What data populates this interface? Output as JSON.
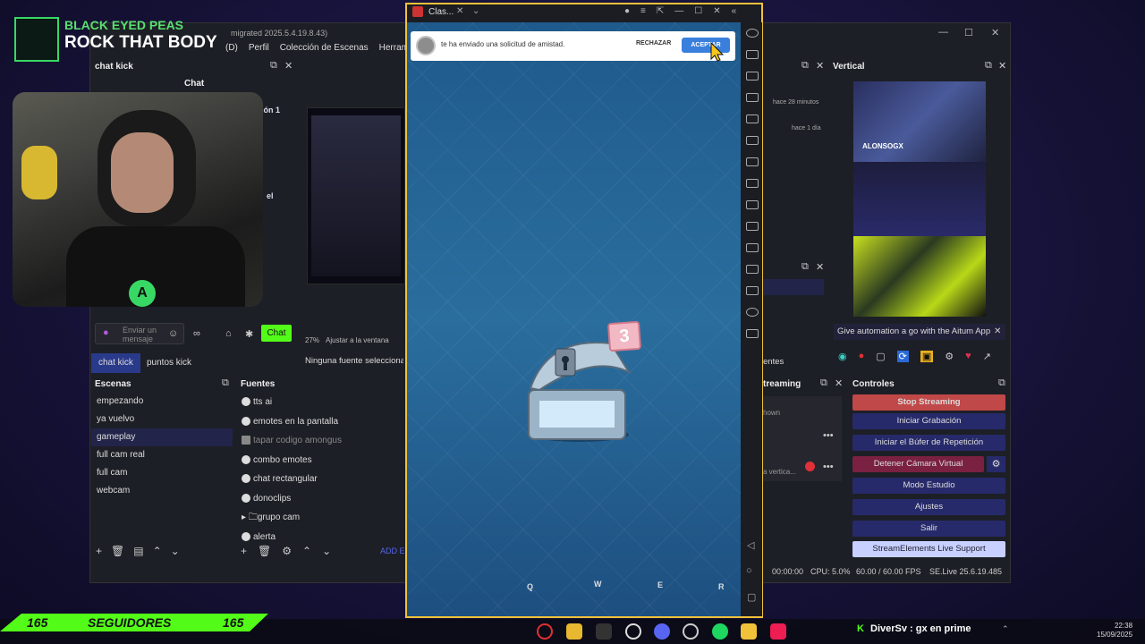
{
  "now_playing": {
    "artist": "BLACK EYED PEAS",
    "song": "ROCK THAT BODY"
  },
  "obs": {
    "window_title": "migrated 2025.5.4.19.8.43)",
    "menu": [
      "(D)",
      "Perfil",
      "Colección de Escenas",
      "Herramienta"
    ],
    "chat_dock_title": "chat kick",
    "chat_header": "Chat",
    "chat_placeholder": "Enviar un mensaje",
    "chat_send": "Chat",
    "tabs": [
      "chat kick",
      "puntos kick"
    ],
    "zoom": "27%",
    "zoom_mode": "Ajustar a la ventana",
    "no_source": "Ninguna fuente seleccionada",
    "partial_left_1": "ión 1",
    "partial_left_2": "el",
    "scenes_title": "Escenas",
    "scenes": [
      "empezando",
      "ya vuelvo",
      "gameplay",
      "full cam real",
      "full cam",
      "webcam"
    ],
    "sources_title": "Fuentes",
    "sources": [
      "tts ai",
      "emotes en la pantalla",
      "tapar codigo amongus",
      "combo emotes",
      "chat rectangular",
      "donoclips",
      "grupo cam",
      "alerta"
    ],
    "add_label": "ADD EL",
    "activity": [
      "hace 28 minutos",
      "hace 1 día"
    ],
    "vertical_title": "Vertical",
    "vertical_name": "ALONSOGX",
    "aitum_text": "Give automation a go with the Aitum App",
    "streaming_title": "treaming",
    "streaming_rows": [
      "hown",
      "a vertica..."
    ],
    "fuentes_partial": "entes",
    "controls_title": "Controles",
    "controls": [
      "Stop Streaming",
      "Iniciar Grabación",
      "Iniciar el Búfer de Repetición",
      "Detener Cámara Virtual",
      "Modo Estudio",
      "Ajustes",
      "Salir",
      "StreamElements Live Support"
    ],
    "status_time": "00:00:00",
    "status_cpu": "CPU: 5.0%",
    "status_fps": "60.00 / 60.00 FPS",
    "status_version": "SE.Live 25.6.19.485"
  },
  "emulator": {
    "tab_title": "Clas...",
    "notification": "te ha enviado una solicitud de amistad.",
    "reject": "RECHAZAR",
    "accept": "ACEPTAR",
    "chest_count": "3",
    "keys": [
      "Q",
      "W",
      "E",
      "R"
    ]
  },
  "banner": {
    "left": "165",
    "label": "SEGUIDORES",
    "right": "165"
  },
  "taskbar": {
    "chat_ticker": "DiverSv : gx en prime",
    "time": "22:38",
    "date": "15/09/2025"
  },
  "colors": {
    "kick_green": "#53fc18",
    "emulator_border": "#f0c23a",
    "control_blue": "#272a6a",
    "stop_red": "#c04848"
  }
}
